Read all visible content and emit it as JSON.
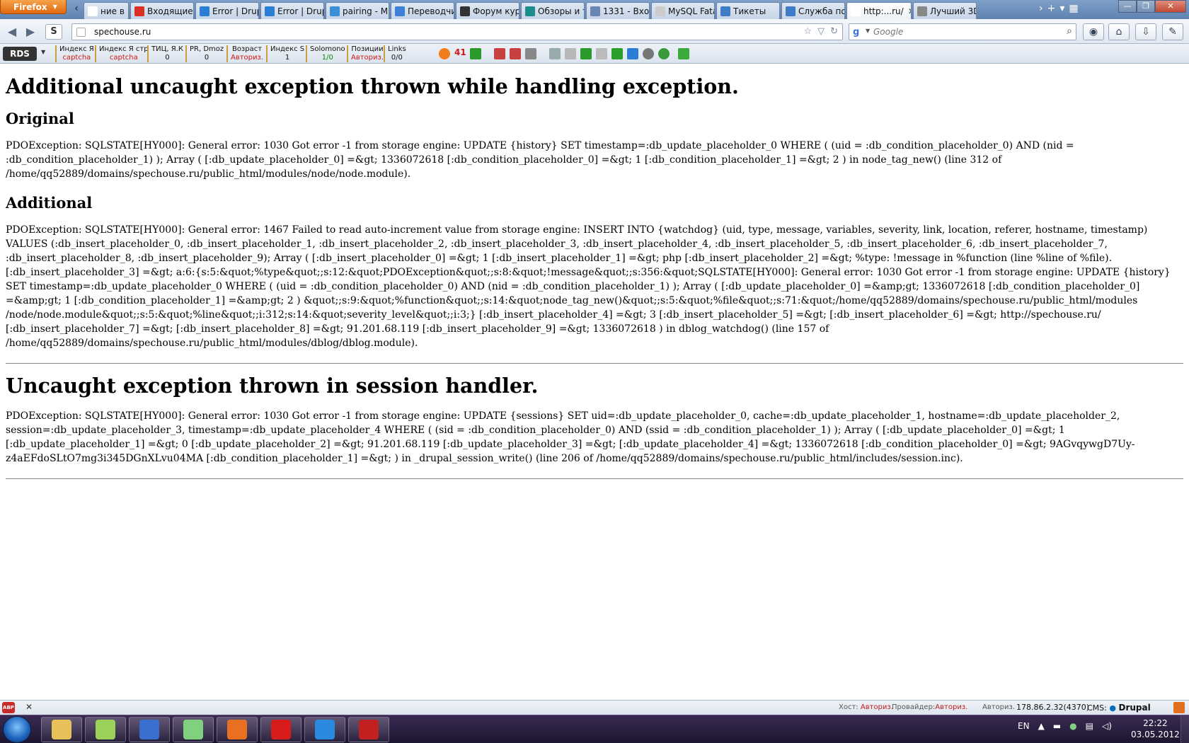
{
  "browser": {
    "menu_button_label": "Firefox",
    "tabs": [
      {
        "label": "ние в ...",
        "color": "#ffffff"
      },
      {
        "label": "Входящие (...",
        "color": "#d93025"
      },
      {
        "label": "Error | Drupal",
        "color": "#2a7fd4"
      },
      {
        "label": "Error | Drupal",
        "color": "#2a7fd4"
      },
      {
        "label": "pairing - M...",
        "color": "#3a8fd8"
      },
      {
        "label": "Переводчи...",
        "color": "#3b82d6"
      },
      {
        "label": "Форум кур...",
        "color": "#333333"
      },
      {
        "label": "Обзоры и т...",
        "color": "#1c8c8c"
      },
      {
        "label": "1331 - Входя...",
        "color": "#6a87b3"
      },
      {
        "label": "MySQL Fata...",
        "color": "#cccccc"
      },
      {
        "label": "Тикеты",
        "color": "#3e7cc8"
      },
      {
        "label": "Служба по...",
        "color": "#3e7cc8"
      },
      {
        "label": "http:...ru/",
        "color": "#ffffff",
        "active": true
      },
      {
        "label": "Лучший 3D...",
        "color": "#888888"
      }
    ],
    "url": "spechouse.ru",
    "search_placeholder": "Google",
    "search_engine_letter": "g"
  },
  "rds": {
    "logo": "RDS",
    "metrics": [
      {
        "label": "Индекс Я",
        "value": "captcha",
        "value_color": "red"
      },
      {
        "label": "Индекс Я стр",
        "value": "captcha",
        "value_color": "red"
      },
      {
        "label": "ТИЦ, Я.К",
        "value": "0"
      },
      {
        "label": "PR, Dmoz",
        "value": "0"
      },
      {
        "label": "Возраст",
        "value": "Авториз.",
        "value_color": "red"
      },
      {
        "label": "Индекс S",
        "value": "1"
      },
      {
        "label": "Solomono",
        "value": "1/0",
        "value_color": "green"
      },
      {
        "label": "Позиции",
        "value": "Авториз.",
        "value_color": "red"
      },
      {
        "label": "Links",
        "value": "0/0"
      }
    ],
    "counter": "41"
  },
  "content": {
    "h1_additional": "Additional uncaught exception thrown while handling exception.",
    "h2_original": "Original",
    "original_text": "PDOException: SQLSTATE[HY000]: General error: 1030 Got error -1 from storage engine: UPDATE {history} SET timestamp=:db_update_placeholder_0 WHERE ( (uid = :db_condition_placeholder_0) AND (nid = :db_condition_placeholder_1) ); Array ( [:db_update_placeholder_0] =&gt; 1336072618 [:db_condition_placeholder_0] =&gt; 1 [:db_condition_placeholder_1] =&gt; 2 ) in node_tag_new() (line 312 of /home/qq52889/domains/spechouse.ru/public_html/modules/node/node.module).",
    "h2_additional": "Additional",
    "additional_text": "PDOException: SQLSTATE[HY000]: General error: 1467 Failed to read auto-increment value from storage engine: INSERT INTO {watchdog} (uid, type, message, variables, severity, link, location, referer, hostname, timestamp) VALUES (:db_insert_placeholder_0, :db_insert_placeholder_1, :db_insert_placeholder_2, :db_insert_placeholder_3, :db_insert_placeholder_4, :db_insert_placeholder_5, :db_insert_placeholder_6, :db_insert_placeholder_7, :db_insert_placeholder_8, :db_insert_placeholder_9); Array ( [:db_insert_placeholder_0] =&gt; 1 [:db_insert_placeholder_1] =&gt; php [:db_insert_placeholder_2] =&gt; %type: !message in %function (line %line of %file). [:db_insert_placeholder_3] =&gt; a:6:{s:5:&quot;%type&quot;;s:12:&quot;PDOException&quot;;s:8:&quot;!message&quot;;s:356:&quot;SQLSTATE[HY000]: General error: 1030 Got error -1 from storage engine: UPDATE {history} SET timestamp=:db_update_placeholder_0 WHERE ( (uid = :db_condition_placeholder_0) AND (nid = :db_condition_placeholder_1) ); Array ( [:db_update_placeholder_0] =&amp;gt; 1336072618 [:db_condition_placeholder_0] =&amp;gt; 1 [:db_condition_placeholder_1] =&amp;gt; 2 ) &quot;;s:9:&quot;%function&quot;;s:14:&quot;node_tag_new()&quot;;s:5:&quot;%file&quot;;s:71:&quot;/home/qq52889/domains/spechouse.ru/public_html/modules /node/node.module&quot;;s:5:&quot;%line&quot;;i:312;s:14:&quot;severity_level&quot;;i:3;} [:db_insert_placeholder_4] =&gt; 3 [:db_insert_placeholder_5] =&gt; [:db_insert_placeholder_6] =&gt; http://spechouse.ru/ [:db_insert_placeholder_7] =&gt; [:db_insert_placeholder_8] =&gt; 91.201.68.119 [:db_insert_placeholder_9] =&gt; 1336072618 ) in dblog_watchdog() (line 157 of /home/qq52889/domains/spechouse.ru/public_html/modules/dblog/dblog.module).",
    "h1_session": "Uncaught exception thrown in session handler.",
    "session_text": "PDOException: SQLSTATE[HY000]: General error: 1030 Got error -1 from storage engine: UPDATE {sessions} SET uid=:db_update_placeholder_0, cache=:db_update_placeholder_1, hostname=:db_update_placeholder_2, session=:db_update_placeholder_3, timestamp=:db_update_placeholder_4 WHERE ( (sid = :db_condition_placeholder_0) AND (ssid = :db_condition_placeholder_1) ); Array ( [:db_update_placeholder_0] =&gt; 1 [:db_update_placeholder_1] =&gt; 0 [:db_update_placeholder_2] =&gt; 91.201.68.119 [:db_update_placeholder_3] =&gt; [:db_update_placeholder_4] =&gt; 1336072618 [:db_condition_placeholder_0] =&gt; 9AGvqywgD7Uy-z4aEFdoSLtO7mg3i345DGnXLvu04MA [:db_condition_placeholder_1] =&gt; ) in _drupal_session_write() (line 206 of /home/qq52889/domains/spechouse.ru/public_html/includes/session.inc)."
  },
  "statusbar": {
    "abp_label": "ABP",
    "host_label": "Хост:",
    "host_value": "Авториз.",
    "provider_label": "Провайдер:",
    "provider_value": "Авториз.",
    "auth_value": "Авториз.",
    "ip": "178.86.2.32(4370)",
    "cms_label": "CMS:",
    "cms_value": "Drupal"
  },
  "taskbar": {
    "items": [
      {
        "name": "explorer",
        "color": "#e8c05a"
      },
      {
        "name": "notepad-plus",
        "color": "#9bd05a"
      },
      {
        "name": "save-disk",
        "color": "#3a6fd0"
      },
      {
        "name": "recycle-bin",
        "color": "#7fd07f"
      },
      {
        "name": "firefox",
        "color": "#e87020"
      },
      {
        "name": "opera",
        "color": "#d81c1c"
      },
      {
        "name": "internet-explorer",
        "color": "#2a8ae0"
      },
      {
        "name": "app-red",
        "color": "#c02020"
      }
    ],
    "language": "EN",
    "time": "22:22",
    "date": "03.05.2012"
  }
}
